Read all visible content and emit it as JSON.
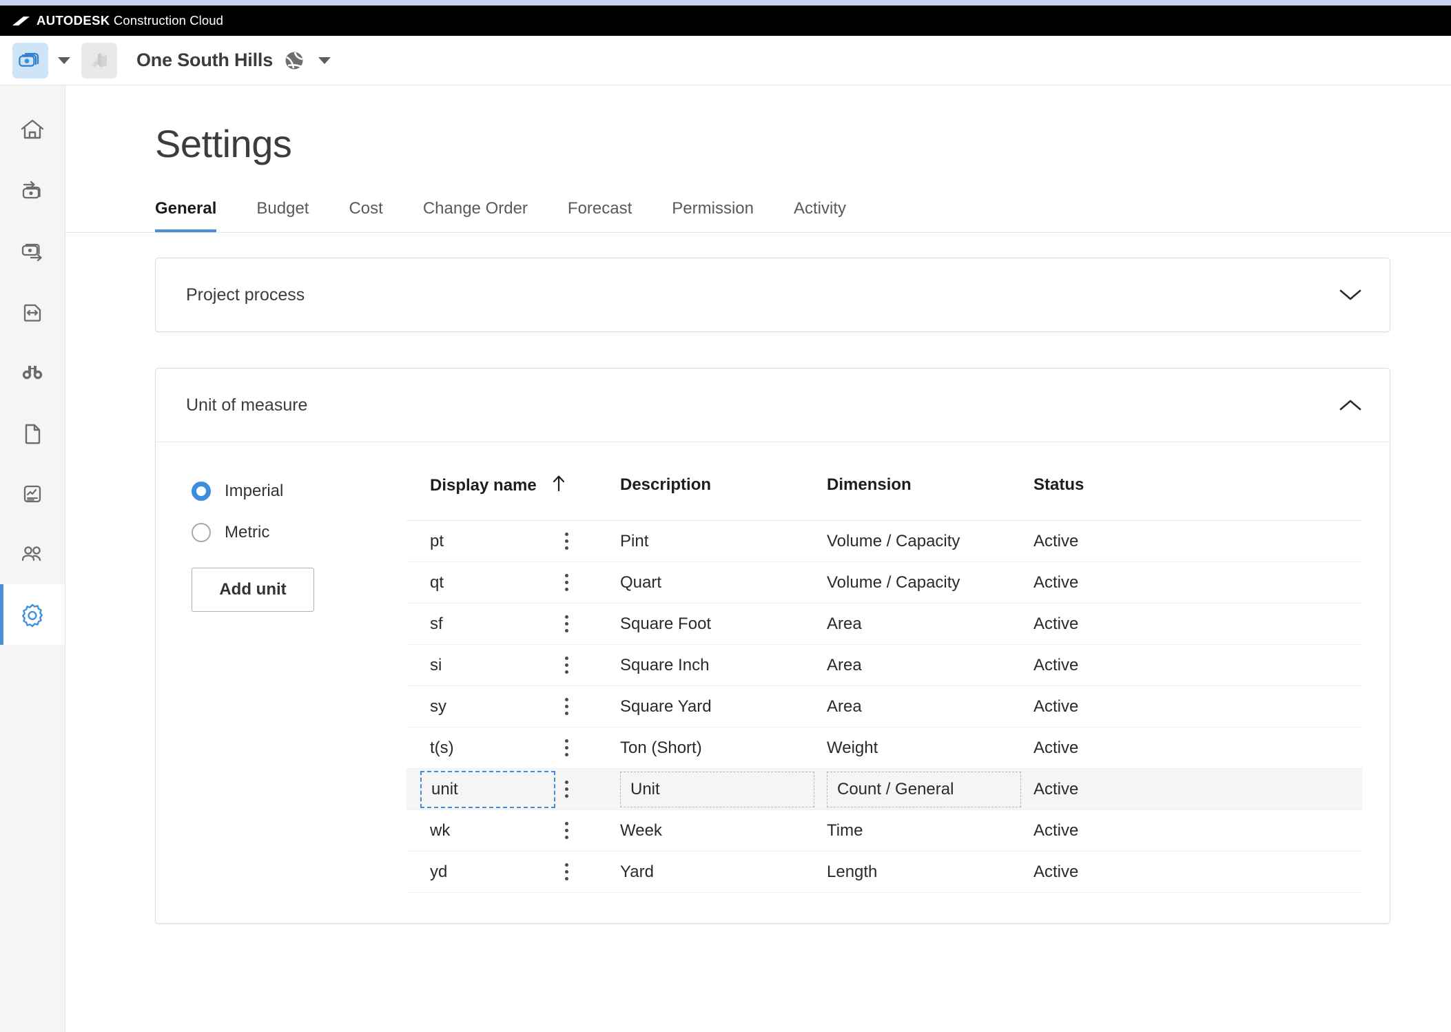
{
  "accent_color": "#4a90d9",
  "top_bar": {
    "brand_bold": "AUTODESK",
    "brand_light": " Construction Cloud"
  },
  "project_bar": {
    "app_switcher_icon": "cost-module-icon",
    "app_switcher_caret_icon": "caret-down-icon",
    "building_icon": "building-icon",
    "project_name": "One South Hills",
    "project_globe_icon": "globe-icon",
    "project_caret_icon": "caret-down-icon"
  },
  "sidebar": {
    "items": [
      {
        "icon": "home-icon",
        "name": "sidebar-item-home",
        "selected": false
      },
      {
        "icon": "money-in-icon",
        "name": "sidebar-item-income",
        "selected": false
      },
      {
        "icon": "money-out-icon",
        "name": "sidebar-item-expense",
        "selected": false
      },
      {
        "icon": "document-arrows-icon",
        "name": "sidebar-item-change-order",
        "selected": false
      },
      {
        "icon": "binoculars-icon",
        "name": "sidebar-item-forecast",
        "selected": false
      },
      {
        "icon": "page-icon",
        "name": "sidebar-item-documents",
        "selected": false
      },
      {
        "icon": "report-chart-icon",
        "name": "sidebar-item-reports",
        "selected": false
      },
      {
        "icon": "people-icon",
        "name": "sidebar-item-members",
        "selected": false
      },
      {
        "icon": "gear-icon",
        "name": "sidebar-item-settings",
        "selected": true
      }
    ]
  },
  "page": {
    "title": "Settings"
  },
  "tabs": [
    {
      "label": "General",
      "active": true
    },
    {
      "label": "Budget",
      "active": false
    },
    {
      "label": "Cost",
      "active": false
    },
    {
      "label": "Change Order",
      "active": false
    },
    {
      "label": "Forecast",
      "active": false
    },
    {
      "label": "Permission",
      "active": false
    },
    {
      "label": "Activity",
      "active": false
    }
  ],
  "cards": {
    "project_process": {
      "title": "Project process",
      "expanded": false,
      "chevron_icon": "chevron-down-icon"
    },
    "unit_of_measure": {
      "title": "Unit of measure",
      "expanded": true,
      "chevron_icon": "chevron-up-icon"
    }
  },
  "unit_system": {
    "options": [
      {
        "label": "Imperial",
        "selected": true
      },
      {
        "label": "Metric",
        "selected": false
      }
    ],
    "add_unit_label": "Add unit"
  },
  "table": {
    "columns": [
      {
        "key": "display_name",
        "label": "Display name",
        "sorted": true,
        "sort_icon": "arrow-up-icon"
      },
      {
        "key": "description",
        "label": "Description",
        "sorted": false
      },
      {
        "key": "dimension",
        "label": "Dimension",
        "sorted": false
      },
      {
        "key": "status",
        "label": "Status",
        "sorted": false
      }
    ],
    "kebab_icon": "more-vertical-icon",
    "rows": [
      {
        "display_name": "pt",
        "description": "Pint",
        "dimension": "Volume / Capacity",
        "status": "Active",
        "editing": false
      },
      {
        "display_name": "qt",
        "description": "Quart",
        "dimension": "Volume / Capacity",
        "status": "Active",
        "editing": false
      },
      {
        "display_name": "sf",
        "description": "Square Foot",
        "dimension": "Area",
        "status": "Active",
        "editing": false
      },
      {
        "display_name": "si",
        "description": "Square Inch",
        "dimension": "Area",
        "status": "Active",
        "editing": false
      },
      {
        "display_name": "sy",
        "description": "Square Yard",
        "dimension": "Area",
        "status": "Active",
        "editing": false
      },
      {
        "display_name": "t(s)",
        "description": "Ton (Short)",
        "dimension": "Weight",
        "status": "Active",
        "editing": false
      },
      {
        "display_name": "unit",
        "description": "Unit",
        "dimension": "Count / General",
        "status": "Active",
        "editing": true
      },
      {
        "display_name": "wk",
        "description": "Week",
        "dimension": "Time",
        "status": "Active",
        "editing": false
      },
      {
        "display_name": "yd",
        "description": "Yard",
        "dimension": "Length",
        "status": "Active",
        "editing": false
      }
    ]
  }
}
